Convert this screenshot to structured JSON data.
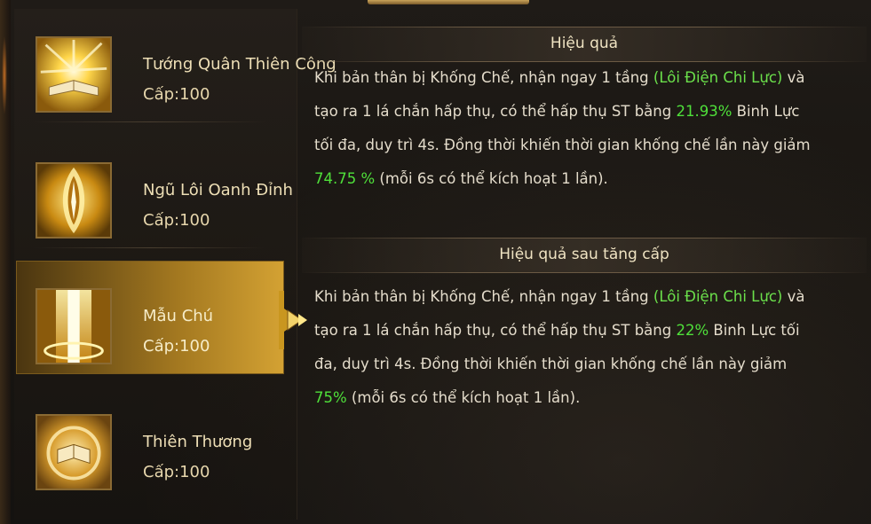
{
  "skills": [
    {
      "name": "Tướng Quân Thiên Công",
      "level": "Cấp:100",
      "icon": "open-book-burst-icon",
      "selected": false
    },
    {
      "name": "Ngũ Lôi Oanh Đỉnh",
      "level": "Cấp:100",
      "icon": "lightning-slash-icon",
      "selected": false
    },
    {
      "name": "Mẫu Chú",
      "level": "Cấp:100",
      "icon": "golden-light-pillar-icon",
      "selected": true
    },
    {
      "name": "Thiên Thương",
      "level": "Cấp:100",
      "icon": "golden-tome-icon",
      "selected": false
    }
  ],
  "effect": {
    "title": "Hiệu quả",
    "text": {
      "p1": "Khi bản thân bị Khống Chế, nhận ngay 1 tầng ",
      "buff": "(Lôi Điện Chi Lực)",
      "p2": " và tạo ra 1 lá chắn hấp thụ, có thể hấp thụ ST bằng ",
      "v1": "21.93%",
      "p3": " Binh Lực tối đa, duy trì 4s. Đồng thời khiến thời gian khống chế lần này giảm ",
      "v2": "74.75 %",
      "p4": " (mỗi 6s có thể kích hoạt 1 lần)."
    }
  },
  "upgrade": {
    "title": "Hiệu quả sau tăng cấp",
    "text": {
      "p1": "Khi bản thân bị Khống Chế, nhận ngay 1 tầng ",
      "buff": "(Lôi Điện Chi Lực)",
      "p2": " và tạo ra 1 lá chắn hấp thụ, có thể hấp thụ ST bằng ",
      "v1": "22%",
      "p3": " Binh Lực tối đa, duy trì 4s. Đồng thời khiến thời gian khống chế lần này giảm ",
      "v2": "75%",
      "p4": " (mỗi 6s có thể kích hoạt 1 lần)."
    }
  },
  "colors": {
    "highlight_name": "#6be04b",
    "highlight_value": "#4fe03a",
    "body_text": "#e4dccb",
    "selected_gold": "#d4a233"
  }
}
